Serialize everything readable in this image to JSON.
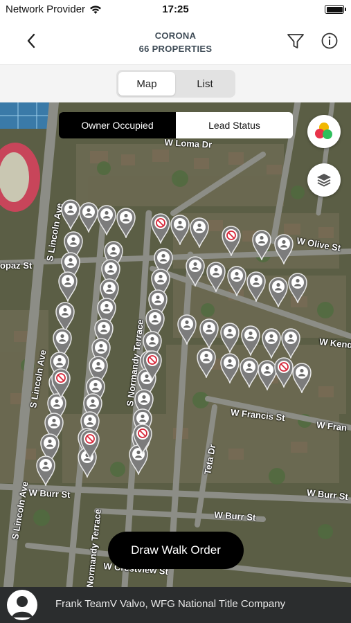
{
  "status": {
    "carrier": "Network Provider",
    "time": "17:25"
  },
  "header": {
    "title": "CORONA",
    "subtitle": "66 PROPERTIES"
  },
  "view_toggle": {
    "map": "Map",
    "list": "List"
  },
  "map": {
    "mode_toggle": {
      "owner_occupied": "Owner Occupied",
      "lead_status": "Lead Status"
    },
    "streets": [
      "S Lincoln Ave",
      "S Lincoln Ave",
      "S Lincoln Ave",
      "opaz St",
      "S Normandy Terrace",
      "W Olive St",
      "W Kend",
      "W Francis St",
      "W Fran",
      "Teta Dr",
      "W Burr St",
      "W Burr St",
      "W Burr St",
      "Normandy Terrace",
      "W Crestview St",
      "W Loma Dr"
    ],
    "accent_colors": [
      "#f2b800",
      "#e8334a",
      "#2fbf5c"
    ],
    "pin_icon": "person-icon",
    "excluded_icon": "no-entry-icon",
    "draw_button": "Draw Walk Order"
  },
  "agent": {
    "label": "Frank TeamV Valvo, WFG National Title Company"
  }
}
